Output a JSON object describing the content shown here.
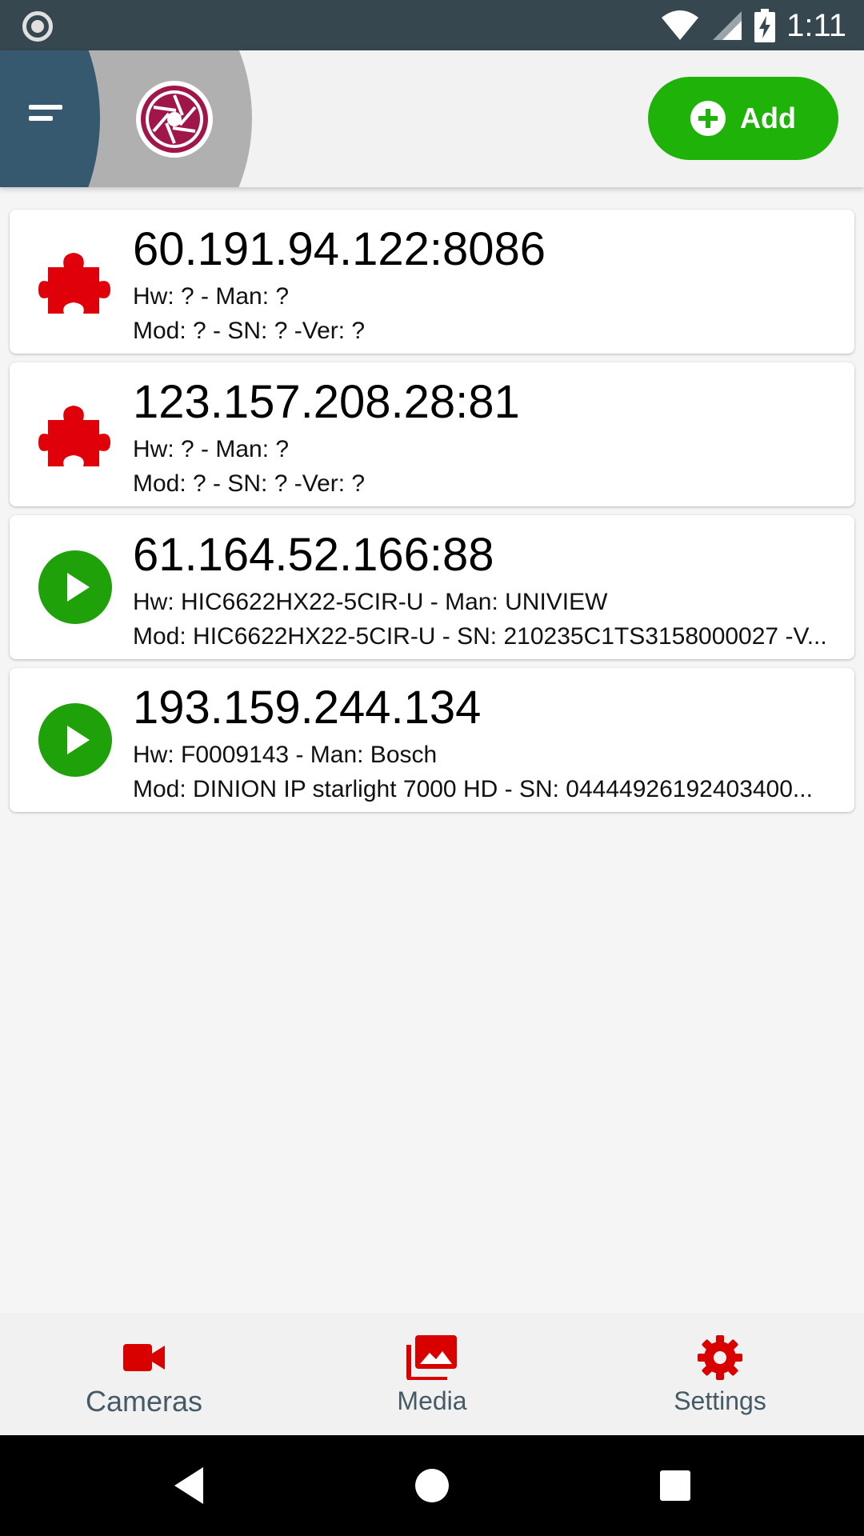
{
  "status_bar": {
    "time": "1:11",
    "icons": [
      "record-indicator-icon",
      "wifi-icon",
      "signal-icon",
      "battery-charging-icon"
    ]
  },
  "header": {
    "menu_icon": "menu-icon",
    "logo_icon": "camera-shutter-logo-icon",
    "add_button_label": "Add"
  },
  "colors": {
    "header_bg": "#f2f2f2",
    "menu_arc": "#37596f",
    "drawer_arc": "#b0b0b0",
    "logo": "#a0154a",
    "add_button": "#1fb30a",
    "error_icon": "#e0000a",
    "online_icon": "#1fa10a",
    "nav_icon": "#d90000"
  },
  "cameras": [
    {
      "status": "plugin-error",
      "icon": "puzzle-piece-icon",
      "title": "60.191.94.122:8086",
      "line1": "Hw: ? - Man: ?",
      "line2": "Mod: ? - SN: ? -Ver: ?"
    },
    {
      "status": "plugin-error",
      "icon": "puzzle-piece-icon",
      "title": "123.157.208.28:81",
      "line1": "Hw: ? - Man: ?",
      "line2": "Mod: ? - SN: ? -Ver: ?"
    },
    {
      "status": "playable",
      "icon": "play-circle-icon",
      "title": "61.164.52.166:88",
      "line1": "Hw: HIC6622HX22-5CIR-U - Man: UNIVIEW",
      "line2": "Mod: HIC6622HX22-5CIR-U - SN: 210235C1TS3158000027 -V..."
    },
    {
      "status": "playable",
      "icon": "play-circle-icon",
      "title": "193.159.244.134",
      "line1": "Hw: F0009143 - Man: Bosch",
      "line2": "Mod: DINION IP starlight 7000 HD - SN: 04444926192403400..."
    }
  ],
  "bottom_nav": [
    {
      "label": "Cameras",
      "icon": "videocam-icon",
      "active": true
    },
    {
      "label": "Media",
      "icon": "photo-library-icon",
      "active": false
    },
    {
      "label": "Settings",
      "icon": "gear-icon",
      "active": false
    }
  ],
  "system_nav": [
    "back-icon",
    "home-icon",
    "recents-icon"
  ]
}
